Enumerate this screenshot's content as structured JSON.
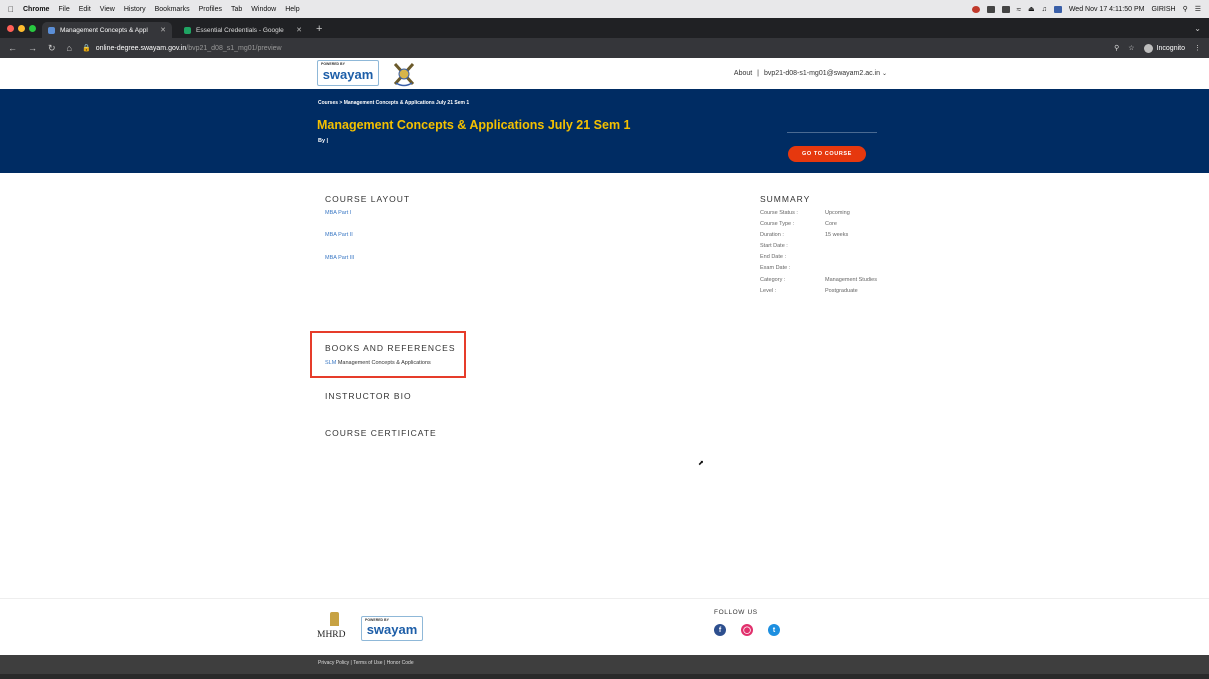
{
  "menubar": {
    "app": "Chrome",
    "items": [
      "File",
      "Edit",
      "View",
      "History",
      "Bookmarks",
      "Profiles",
      "Tab",
      "Window",
      "Help"
    ],
    "clock": "Wed Nov 17  4:11:50 PM",
    "user": "GIRISH"
  },
  "tabs": [
    {
      "title": "Management Concepts & Appl",
      "active": true
    },
    {
      "title": "Essential Credentials - Google",
      "active": false
    }
  ],
  "toolbar": {
    "url_host": "online-degree.swayam.gov.in",
    "url_path": "/bvp21_d08_s1_mg01/preview",
    "profile": "Incognito"
  },
  "header": {
    "logo_powered": "POWERED BY",
    "logo_word": "swayam",
    "about": "About",
    "separator": "|",
    "user_email": "bvp21-d08-s1-mg01@swayam2.ac.in"
  },
  "banner": {
    "breadcrumb": "Courses  >  Management Concepts & Applications July 21 Sem 1",
    "title": "Management Concepts & Applications July 21 Sem 1",
    "by": "By  |",
    "go_button": "GO TO COURSE"
  },
  "course_layout": {
    "heading": "COURSE LAYOUT",
    "items": [
      "MBA Part I",
      "MBA Part II",
      "MBA Part III"
    ]
  },
  "summary": {
    "heading": "SUMMARY",
    "rows": [
      {
        "key": "Course Status :",
        "value": "Upcoming"
      },
      {
        "key": "Course Type :",
        "value": "Core"
      },
      {
        "key": "Duration :",
        "value": "15 weeks"
      },
      {
        "key": "Start Date :",
        "value": ""
      },
      {
        "key": "End Date :",
        "value": ""
      },
      {
        "key": "Exam Date :",
        "value": ""
      },
      {
        "key": "Category :",
        "value": "Management Studies"
      },
      {
        "key": "Level :",
        "value": "Postgraduate"
      }
    ]
  },
  "books": {
    "heading": "BOOKS AND REFERENCES",
    "link": "SLM",
    "rest": " Management Concepts & Applications"
  },
  "instructor_bio": "INSTRUCTOR BIO",
  "course_certificate": "COURSE CERTIFICATE",
  "footer": {
    "mhrd": "MHRD",
    "follow_us": "FOLLOW US",
    "links": "Privacy Policy | Terms of Use | Honor Code"
  },
  "colors": {
    "banner": "#002c63",
    "title": "#f4c000",
    "go_button": "#e6380e",
    "highlight_box": "#e63c2a",
    "link": "#3a78c4"
  }
}
